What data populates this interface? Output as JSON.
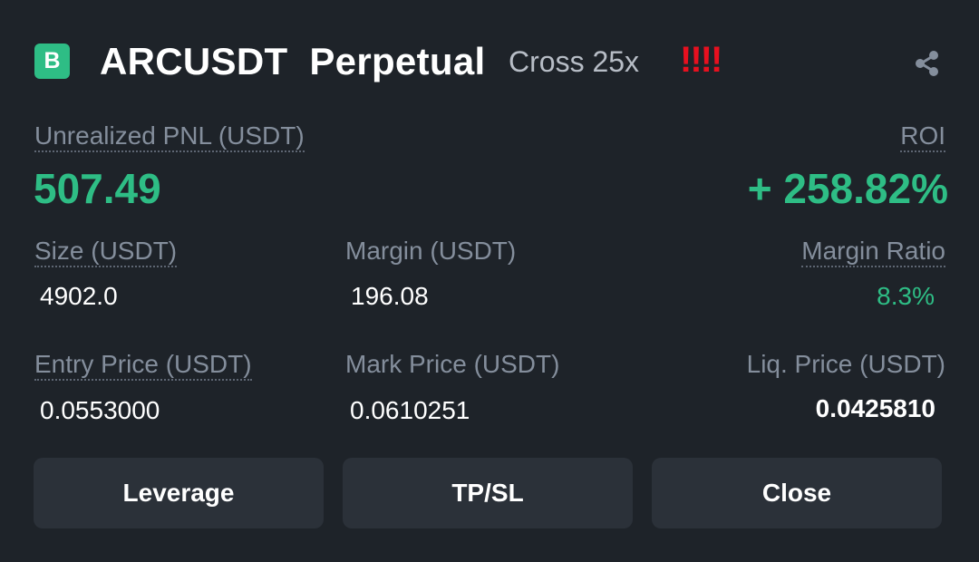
{
  "header": {
    "badge": "B",
    "symbol": "ARCUSDT  Perpetual",
    "margin_mode": "Cross 25x",
    "warning": "!!!!",
    "share_icon": "share-icon"
  },
  "pnl": {
    "label": "Unrealized PNL (USDT)",
    "value": "507.49"
  },
  "roi": {
    "label": "ROI",
    "value": "+ 258.82%"
  },
  "size": {
    "label": "Size (USDT)",
    "value": "4902.0"
  },
  "margin": {
    "label": "Margin (USDT)",
    "value": "196.08"
  },
  "margin_ratio": {
    "label": "Margin Ratio",
    "value": "8.3%"
  },
  "entry_price": {
    "label": "Entry Price (USDT)",
    "value": "0.0553000"
  },
  "mark_price": {
    "label": "Mark Price (USDT)",
    "value": "0.0610251"
  },
  "liq_price": {
    "label": "Liq. Price (USDT)",
    "value": "0.0425810"
  },
  "buttons": {
    "leverage": "Leverage",
    "tpsl": "TP/SL",
    "close": "Close"
  },
  "colors": {
    "background": "#1e2329",
    "positive": "#2ebd85",
    "warning": "#e8101f",
    "button": "#2b3139"
  }
}
